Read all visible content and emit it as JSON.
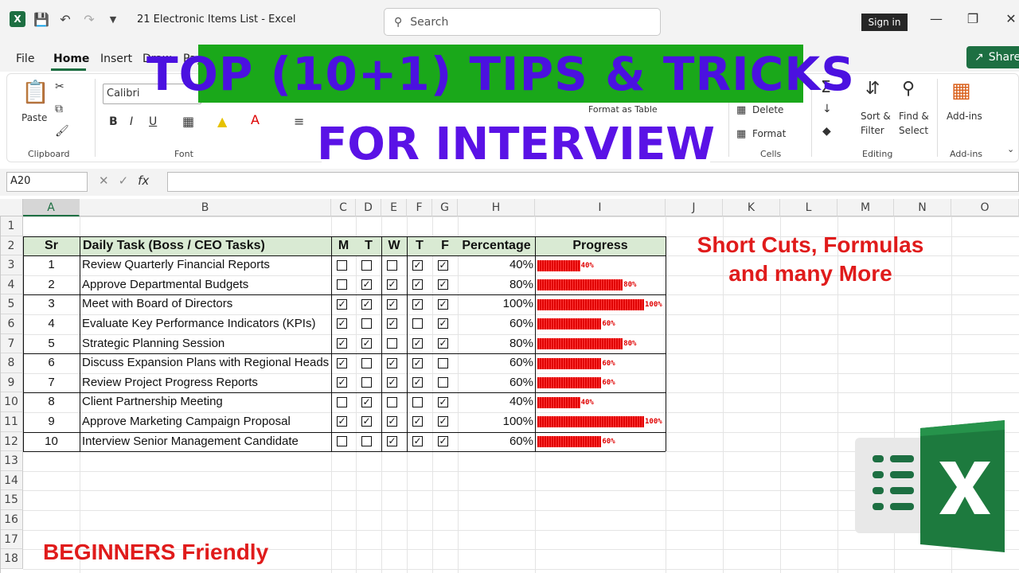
{
  "app": {
    "doc_title": "21 Electronic Items List  -  Excel",
    "search_placeholder": "Search",
    "sign_in": "Sign in",
    "share": "Share"
  },
  "menu": [
    "File",
    "Home",
    "Insert",
    "Draw",
    "Pag"
  ],
  "ribbon": {
    "paste": "Paste",
    "clipboard": "Clipboard",
    "font_name": "Calibri",
    "font": "Font",
    "format_as_table": "Format as Table",
    "delete": "Delete",
    "format": "Format",
    "cells": "Cells",
    "sort_filter": "Sort &",
    "filter": "Filter",
    "find_select": "Find &",
    "select": "Select",
    "editing": "Editing",
    "addins_btn": "Add-ins",
    "addins": "Add-ins"
  },
  "banner": {
    "line1": "TOP (10+1) TIPS & TRICKS",
    "line2": "FOR INTERVIEW"
  },
  "formula_bar": {
    "name_box": "A20",
    "fx": "fx"
  },
  "columns": [
    "A",
    "B",
    "C",
    "D",
    "E",
    "F",
    "G",
    "H",
    "I",
    "J",
    "K",
    "L",
    "M",
    "N",
    "O"
  ],
  "rows": [
    "1",
    "2",
    "3",
    "4",
    "5",
    "6",
    "7",
    "8",
    "9",
    "10",
    "11",
    "12",
    "13",
    "14",
    "15",
    "16",
    "17",
    "18"
  ],
  "table": {
    "headers": [
      "Sr",
      "Daily Task (Boss / CEO Tasks)",
      "M",
      "T",
      "W",
      "T",
      "F",
      "Percentage",
      "Progress"
    ],
    "rows": [
      {
        "sr": "1",
        "task": "Review Quarterly Financial Reports",
        "checks": [
          false,
          false,
          false,
          true,
          true
        ],
        "pct": "40%",
        "value": 0.4
      },
      {
        "sr": "2",
        "task": "Approve Departmental Budgets",
        "checks": [
          false,
          true,
          true,
          true,
          true
        ],
        "pct": "80%",
        "value": 0.8
      },
      {
        "sr": "3",
        "task": "Meet with Board of Directors",
        "checks": [
          true,
          true,
          true,
          true,
          true
        ],
        "pct": "100%",
        "value": 1.0
      },
      {
        "sr": "4",
        "task": "Evaluate Key Performance Indicators (KPIs)",
        "checks": [
          true,
          false,
          true,
          false,
          true
        ],
        "pct": "60%",
        "value": 0.6
      },
      {
        "sr": "5",
        "task": "Strategic Planning Session",
        "checks": [
          true,
          true,
          false,
          true,
          true
        ],
        "pct": "80%",
        "value": 0.8
      },
      {
        "sr": "6",
        "task": "Discuss Expansion Plans with Regional Heads",
        "checks": [
          true,
          false,
          true,
          true,
          false
        ],
        "pct": "60%",
        "value": 0.6
      },
      {
        "sr": "7",
        "task": "Review Project Progress Reports",
        "checks": [
          true,
          false,
          true,
          true,
          false
        ],
        "pct": "60%",
        "value": 0.6
      },
      {
        "sr": "8",
        "task": "Client Partnership Meeting",
        "checks": [
          false,
          true,
          false,
          false,
          true
        ],
        "pct": "40%",
        "value": 0.4
      },
      {
        "sr": "9",
        "task": "Approve Marketing Campaign Proposal",
        "checks": [
          true,
          true,
          true,
          true,
          true
        ],
        "pct": "100%",
        "value": 1.0
      },
      {
        "sr": "10",
        "task": "Interview Senior Management Candidate",
        "checks": [
          false,
          false,
          true,
          true,
          true
        ],
        "pct": "60%",
        "value": 0.6
      }
    ]
  },
  "side_text": {
    "line1": "Short Cuts, Formulas",
    "line2": "and many More"
  },
  "footer_text": "BEGINNERS Friendly",
  "colors": {
    "excel_green": "#1d6f42",
    "banner_green": "#1aa81a",
    "banner_text": "#4b11e0",
    "header_fill": "#d9ead3",
    "bar_red": "#e00000",
    "accent_red": "#e01b1b"
  }
}
